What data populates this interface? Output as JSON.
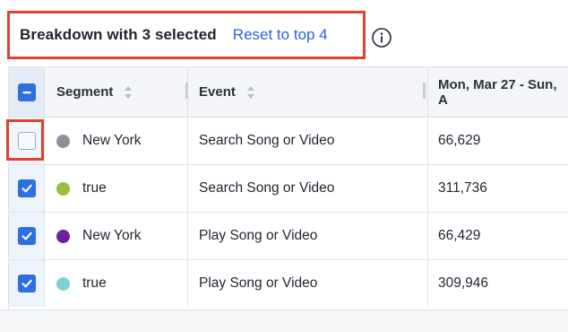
{
  "toolbar": {
    "title": "Breakdown with 3 selected",
    "reset_label": "Reset to top 4",
    "info_icon": "info-circle-icon"
  },
  "table": {
    "columns": {
      "segment": "Segment",
      "event": "Event",
      "date_range": "Mon, Mar 27 - Sun, A"
    },
    "rows": [
      {
        "checked": false,
        "segment": "New York",
        "event": "Search Song or Video",
        "value": "66,629",
        "color": "#8e9099"
      },
      {
        "checked": true,
        "segment": "true",
        "event": "Search Song or Video",
        "value": "311,736",
        "color": "#9bbe3c"
      },
      {
        "checked": true,
        "segment": "New York",
        "event": "Play Song or Video",
        "value": "66,429",
        "color": "#6d1fa6"
      },
      {
        "checked": true,
        "segment": "true",
        "event": "Play Song or Video",
        "value": "309,946",
        "color": "#7dd2d6"
      }
    ]
  },
  "colors": {
    "accent": "#2f6fe4",
    "link": "#2563eb",
    "highlight": "#e1412d"
  }
}
